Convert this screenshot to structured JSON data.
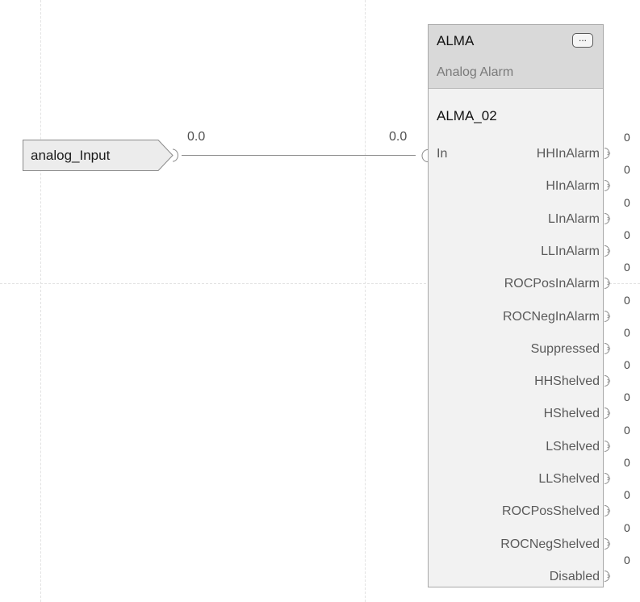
{
  "input_reference": {
    "tag": "analog_Input"
  },
  "wire": {
    "source_value": "0.0",
    "dest_value": "0.0"
  },
  "block": {
    "type": "ALMA",
    "description": "Analog Alarm",
    "tag": "ALMA_02",
    "properties_button": "...",
    "input_label": "In",
    "outputs": [
      {
        "label": "HHInAlarm",
        "value": "0"
      },
      {
        "label": "HInAlarm",
        "value": "0"
      },
      {
        "label": "LInAlarm",
        "value": "0"
      },
      {
        "label": "LLInAlarm",
        "value": "0"
      },
      {
        "label": "ROCPosInAlarm",
        "value": "0"
      },
      {
        "label": "ROCNegInAlarm",
        "value": "0"
      },
      {
        "label": "Suppressed",
        "value": "0"
      },
      {
        "label": "HHShelved",
        "value": "0"
      },
      {
        "label": "HShelved",
        "value": "0"
      },
      {
        "label": "LShelved",
        "value": "0"
      },
      {
        "label": "LLShelved",
        "value": "0"
      },
      {
        "label": "ROCPosShelved",
        "value": "0"
      },
      {
        "label": "ROCNegShelved",
        "value": "0"
      },
      {
        "label": "Disabled",
        "value": "0"
      }
    ]
  }
}
